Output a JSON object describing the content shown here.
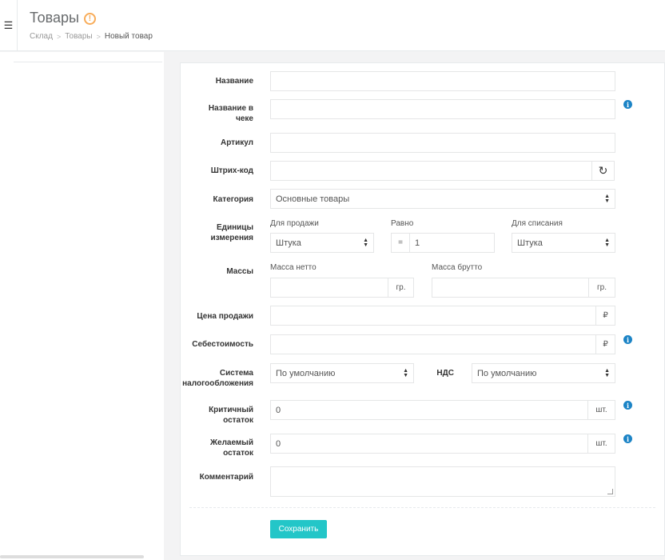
{
  "header": {
    "menu_icon": "☰",
    "title": "Товары",
    "title_badge": "!",
    "breadcrumb": {
      "items": [
        "Склад",
        "Товары",
        "Новый товар"
      ],
      "separator": ">"
    }
  },
  "form": {
    "name": {
      "label": "Название",
      "value": ""
    },
    "receipt_name": {
      "label": "Название в чеке",
      "value": ""
    },
    "article": {
      "label": "Артикул",
      "value": ""
    },
    "barcode": {
      "label": "Штрих-код",
      "value": "",
      "refresh_icon": "↻"
    },
    "category": {
      "label": "Категория",
      "value": "Основные товары"
    },
    "units": {
      "label": "Единицы измерения",
      "sale_label": "Для продажи",
      "sale_value": "Штука",
      "equals_label": "Равно",
      "equals_sign": "=",
      "equals_value": "1",
      "writeoff_label": "Для списания",
      "writeoff_value": "Штука"
    },
    "mass": {
      "label": "Массы",
      "net_label": "Масса нетто",
      "net_value": "",
      "net_unit": "гр.",
      "gross_label": "Масса брутто",
      "gross_value": "",
      "gross_unit": "гр."
    },
    "sale_price": {
      "label": "Цена продажи",
      "value": "",
      "currency": "₽"
    },
    "cost": {
      "label": "Себестоимость",
      "value": "",
      "currency": "₽"
    },
    "tax": {
      "label": "Система налогообложения",
      "value": "По умолчанию",
      "vat_label": "НДС",
      "vat_value": "По умолчанию"
    },
    "critical_stock": {
      "label": "Критичный остаток",
      "value": "0",
      "unit": "шт."
    },
    "desired_stock": {
      "label": "Желаемый остаток",
      "value": "0",
      "unit": "шт."
    },
    "comment": {
      "label": "Комментарий",
      "value": ""
    },
    "info_glyph": "i",
    "save_label": "Сохранить"
  },
  "colors": {
    "accent": "#23c6c8",
    "info": "#1c84c6",
    "warning": "#f8ac59"
  }
}
